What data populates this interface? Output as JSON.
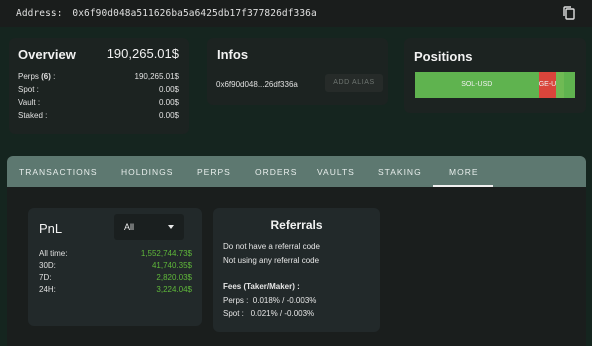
{
  "address_bar": {
    "label": "Address:",
    "value": "0x6f90d048a511626ba5a6425db17f377826df336a",
    "copy_icon": "copy-icon"
  },
  "overview": {
    "title": "Overview",
    "total": "190,265.01$",
    "rows": [
      {
        "label": "Perps",
        "count": "(6)",
        "suffix": " :",
        "value": "190,265.01$"
      },
      {
        "label": "Spot :",
        "value": "0.00$"
      },
      {
        "label": "Vault :",
        "value": "0.00$"
      },
      {
        "label": "Staked :",
        "value": "0.00$"
      }
    ]
  },
  "infos": {
    "title": "Infos",
    "short_address": "0x6f90d048...26df336a",
    "alias_button": "ADD ALIAS"
  },
  "positions": {
    "title": "Positions",
    "segments": [
      {
        "label": "SOL-USD",
        "share": 0.772,
        "color": "#5fb34f"
      },
      {
        "label": "GE-U",
        "share": 0.112,
        "color": "#d9453b"
      },
      {
        "label": "",
        "share": 0.045,
        "color": "#6fba54"
      },
      {
        "label": "",
        "share": 0.071,
        "color": "#5fb34f"
      }
    ]
  },
  "tabs": [
    "TRANSACTIONS",
    "HOLDINGS",
    "PERPS",
    "ORDERS",
    "VAULTS",
    "STAKING",
    "MORE"
  ],
  "active_tab": "MORE",
  "pnl": {
    "title": "PnL",
    "select_value": "All",
    "rows": [
      {
        "label": "All time:",
        "value": "1,552,744.73$"
      },
      {
        "label": "30D:",
        "value": "41,740.35$"
      },
      {
        "label": "7D:",
        "value": "2,820.03$"
      },
      {
        "label": "24H:",
        "value": "3,224.04$"
      }
    ]
  },
  "referrals": {
    "title": "Referrals",
    "line1": "Do not have a referral code",
    "line2": "Not using any referral code",
    "fees_title": "Fees (Taker/Maker) :",
    "perps": "Perps :  0.018% / -0.003%",
    "spot": "Spot :   0.021% / -0.003%"
  },
  "colors": {
    "accent": "#5d7870",
    "positive": "#5fb83a",
    "background": "#15251f"
  }
}
